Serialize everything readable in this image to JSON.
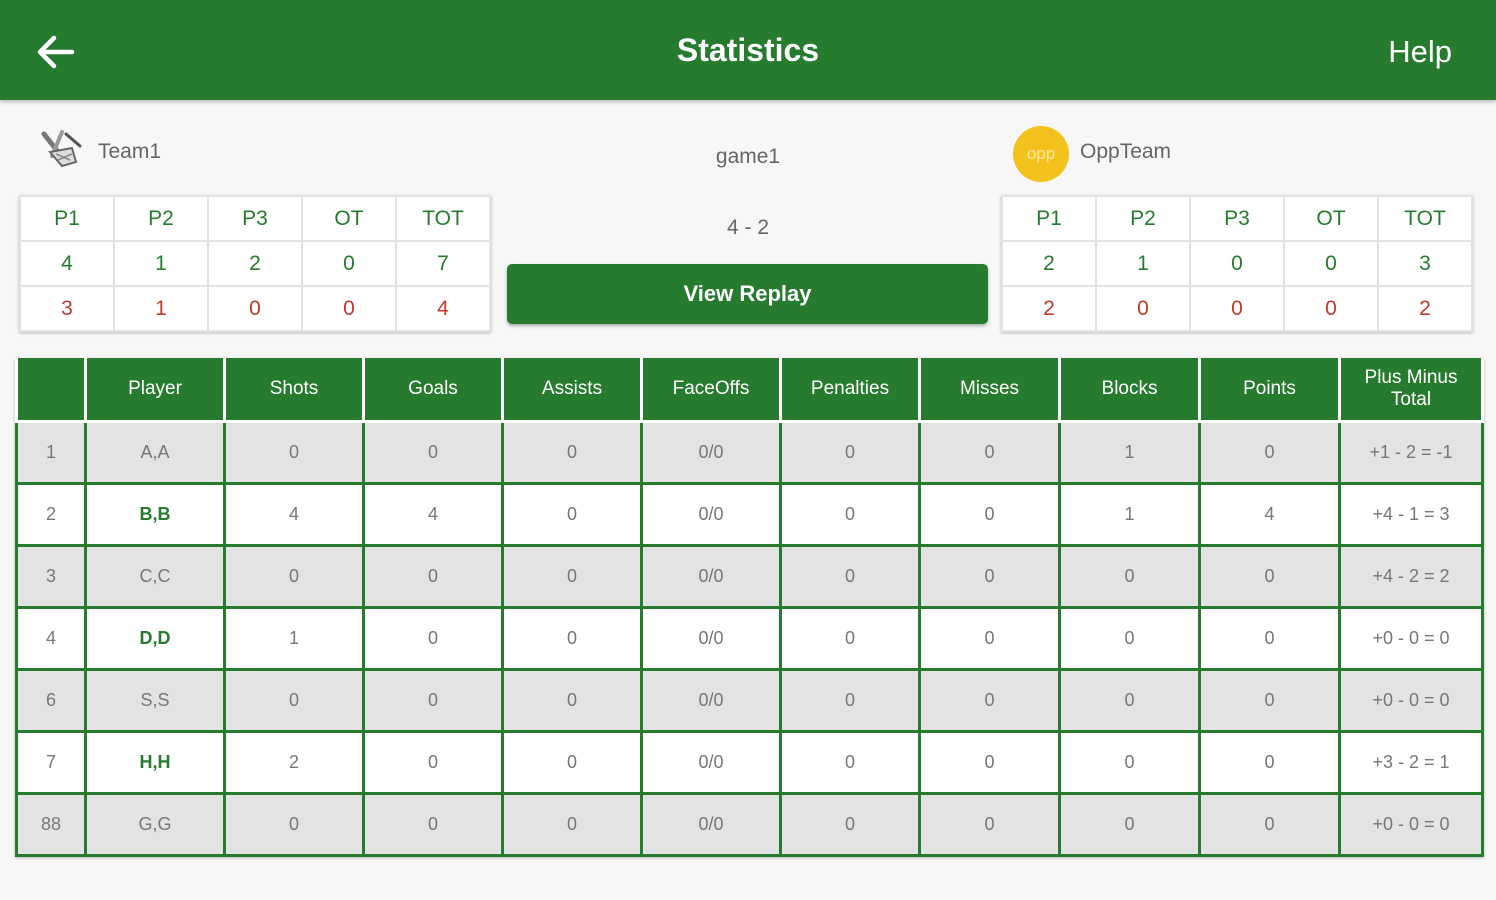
{
  "header": {
    "title": "Statistics",
    "help_label": "Help"
  },
  "game": {
    "name": "game1",
    "score": "4 - 2",
    "replay_label": "View Replay"
  },
  "home_team": {
    "name": "Team1",
    "periods": [
      "P1",
      "P2",
      "P3",
      "OT",
      "TOT"
    ],
    "row1": [
      "4",
      "1",
      "2",
      "0",
      "7"
    ],
    "row2": [
      "3",
      "1",
      "0",
      "0",
      "4"
    ]
  },
  "away_team": {
    "badge": "opp",
    "name": "OppTeam",
    "periods": [
      "P1",
      "P2",
      "P3",
      "OT",
      "TOT"
    ],
    "row1": [
      "2",
      "1",
      "0",
      "0",
      "3"
    ],
    "row2": [
      "2",
      "0",
      "0",
      "0",
      "2"
    ]
  },
  "colors": {
    "primary": "#267b2e",
    "accent_red": "#c0392b",
    "badge_yellow": "#f4c21d"
  },
  "stats": {
    "columns": [
      "",
      "Player",
      "Shots",
      "Goals",
      "Assists",
      "FaceOffs",
      "Penalties",
      "Misses",
      "Blocks",
      "Points",
      "Plus Minus Total"
    ],
    "rows": [
      [
        "1",
        "A,A",
        "0",
        "0",
        "0",
        "0/0",
        "0",
        "0",
        "1",
        "0",
        "+1 - 2 = -1"
      ],
      [
        "2",
        "B,B",
        "4",
        "4",
        "0",
        "0/0",
        "0",
        "0",
        "1",
        "4",
        "+4 - 1 = 3"
      ],
      [
        "3",
        "C,C",
        "0",
        "0",
        "0",
        "0/0",
        "0",
        "0",
        "0",
        "0",
        "+4 - 2 = 2"
      ],
      [
        "4",
        "D,D",
        "1",
        "0",
        "0",
        "0/0",
        "0",
        "0",
        "0",
        "0",
        "+0 - 0 = 0"
      ],
      [
        "6",
        "S,S",
        "0",
        "0",
        "0",
        "0/0",
        "0",
        "0",
        "0",
        "0",
        "+0 - 0 = 0"
      ],
      [
        "7",
        "H,H",
        "2",
        "0",
        "0",
        "0/0",
        "0",
        "0",
        "0",
        "0",
        "+3 - 2 = 1"
      ],
      [
        "88",
        "G,G",
        "0",
        "0",
        "0",
        "0/0",
        "0",
        "0",
        "0",
        "0",
        "+0 - 0 = 0"
      ]
    ],
    "highlighted_players": [
      "B,B",
      "D,D",
      "H,H"
    ]
  }
}
